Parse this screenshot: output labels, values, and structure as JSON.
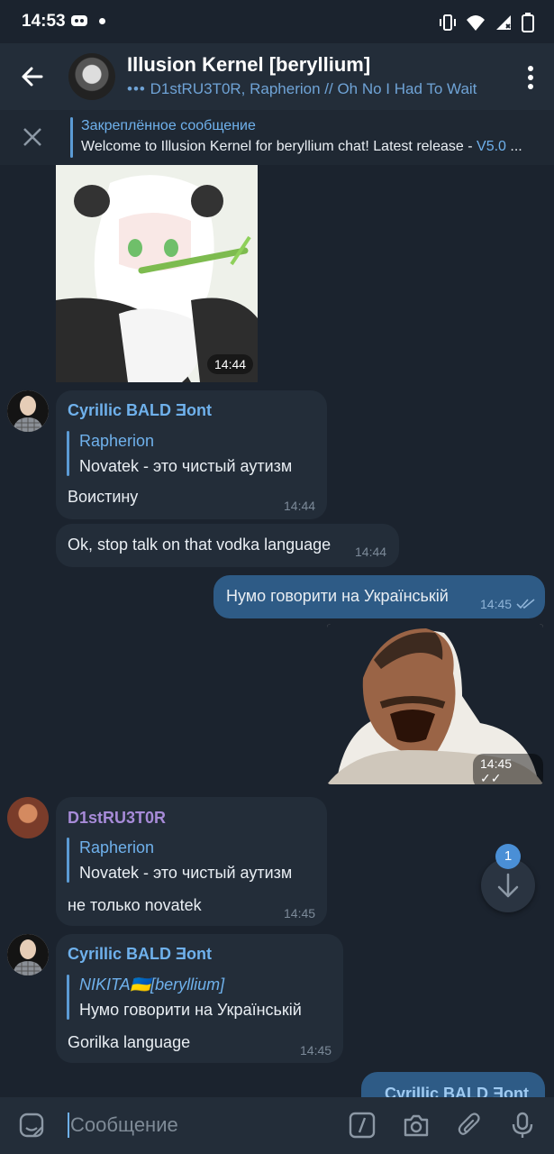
{
  "status": {
    "time": "14:53"
  },
  "header": {
    "title": "Illusion Kernel [beryllium]",
    "subtitle": "D1stRU3T0R, Rapherion // Oh No I Had To Wait"
  },
  "pinned": {
    "title": "Закреплённое сообщение",
    "text": "Welcome to Illusion Kernel for beryllium chat! Latest release - ",
    "link": "V5.0",
    "ellipsis": "..."
  },
  "messages": [
    {
      "type": "image",
      "time": "14:44"
    },
    {
      "type": "in",
      "sender": "Cyrillic BALD Ǝont",
      "reply_name": "Rapherion",
      "reply_text": "Novatek - это чистый аутизм",
      "text": "Воистину",
      "time": "14:44"
    },
    {
      "type": "in",
      "text": "Ok, stop talk on that vodka language",
      "time": "14:44"
    },
    {
      "type": "out",
      "text": "Нумо говорити на Українській",
      "time": "14:45"
    },
    {
      "type": "sticker",
      "time": "14:45"
    },
    {
      "type": "in",
      "sender": "D1stRU3T0R",
      "reply_name": "Rapherion",
      "reply_text": "Novatek - это чистый аутизм",
      "text": "не только novatek",
      "time": "14:45"
    },
    {
      "type": "in",
      "sender": "Cyrillic BALD Ǝont",
      "reply_name": "NIKITA🇺🇦[beryllium]",
      "reply_text": "Нумо говорити на Українській",
      "text": "Gorilka language",
      "time": "14:45"
    },
    {
      "type": "out-partial",
      "sender": "Cyrillic BALD Ǝont"
    }
  ],
  "scroll_badge": "1",
  "input": {
    "placeholder": "Сообщение"
  },
  "colors": {
    "accent": "#6fb1ec",
    "outgoing": "#2e5b86",
    "incoming": "#232d39",
    "bg": "#1b232e",
    "destructor_name": "#a78bd8"
  }
}
